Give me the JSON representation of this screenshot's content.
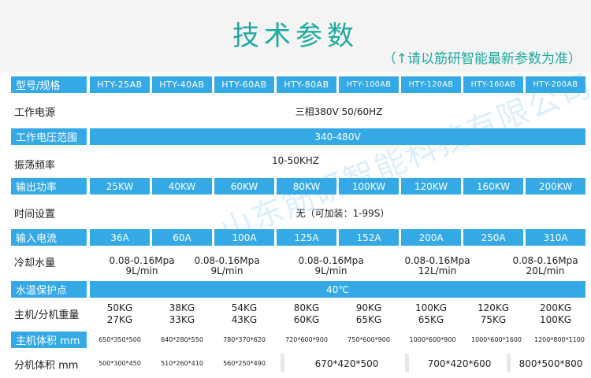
{
  "header": {
    "title": "技术参数",
    "subtitle": "（↑请以筋研智能最新参数为准）"
  },
  "colors": {
    "accent": "#1eaaa0",
    "band": "#34a9e5"
  },
  "models": {
    "label": "型号/规格",
    "values": [
      "HTY-25AB",
      "HTY-40AB",
      "HTY-60AB",
      "HTY-80AB",
      "HTY-100AB",
      "HTY-120AB",
      "HTY-160AB",
      "HTY-200AB"
    ]
  },
  "power_supply": {
    "label": "工作电源",
    "value": "三相380V 50/60HZ"
  },
  "voltage_range": {
    "label": "工作电压范围",
    "value": "340-480V"
  },
  "frequency": {
    "label": "振荡频率",
    "value": "10-50KHZ"
  },
  "output_power": {
    "label": "输出功率",
    "values": [
      "25KW",
      "40KW",
      "60KW",
      "80KW",
      "100KW",
      "120KW",
      "160KW",
      "200KW"
    ]
  },
  "time_setting": {
    "label": "时间设置",
    "value": "无（可加装：1-99S）"
  },
  "input_current": {
    "label": "输入电流",
    "values": [
      "36A",
      "60A",
      "100A",
      "125A",
      "152A",
      "200A",
      "250A",
      "310A"
    ]
  },
  "cooling_water": {
    "label": "冷却水量",
    "groups": [
      {
        "line1": "0.08-0.16Mpa",
        "line2": "9L/min"
      },
      {
        "line1": "0.08-0.16Mpa",
        "line2": "9L/min"
      },
      {
        "line1": "0.08-0.16Mpa",
        "line2": "9L/min"
      },
      {
        "line1": "0.08-0.16Mpa",
        "line2": "12L/min"
      },
      {
        "line1": "0.08-0.16Mpa",
        "line2": "20L/min"
      }
    ]
  },
  "water_protection": {
    "label": "水温保护点",
    "value": "40℃"
  },
  "weight": {
    "label": "主机/分机重量",
    "host": [
      "50KG",
      "38KG",
      "54KG",
      "80KG",
      "90KG",
      "100KG",
      "120KG",
      "200KG"
    ],
    "unit": [
      "27KG",
      "33KG",
      "43KG",
      "60KG",
      "65KG",
      "65KG",
      "75KG",
      "100KG"
    ]
  },
  "host_volume": {
    "label": "主机体积 mm",
    "values": [
      "650*350*500",
      "640*280*550",
      "780*370*620",
      "720*600*900",
      "750*600*900",
      "1000*600*900",
      "1000*600*1600",
      "1200*800*1100"
    ]
  },
  "unit_volume": {
    "label": "分机体积 mm",
    "values": [
      "500*300*450",
      "510*260*410",
      "560*250*490",
      "670*420*500",
      "700*420*600",
      "800*500*800"
    ]
  },
  "watermark": "山东筋研智能科技有限公司"
}
